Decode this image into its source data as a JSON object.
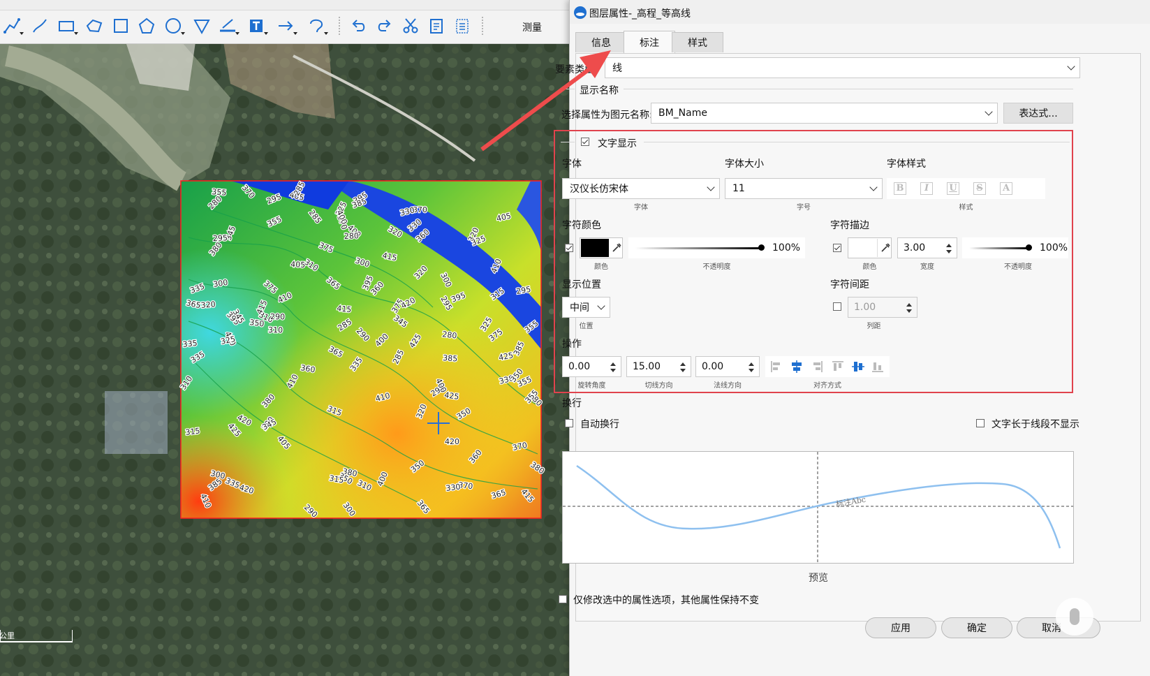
{
  "toolbar": {
    "measure_label": "测量",
    "icons": [
      "polyline-icon",
      "freehand-icon",
      "rectangle-icon",
      "polygon-icon",
      "square-icon",
      "pentagon-icon",
      "circle-icon",
      "triangle-icon",
      "ruler-icon",
      "text-icon",
      "arrow-icon",
      "lasso-icon",
      "undo-icon",
      "redo-icon",
      "scissors-icon",
      "clipboard-icon",
      "list-icon"
    ]
  },
  "map": {
    "scale_label": "公里",
    "contour_labels": [
      "335",
      "310",
      "300",
      "365",
      "370",
      "380",
      "400",
      "410",
      "420",
      "350",
      "320",
      "355",
      "360",
      "395",
      "385",
      "375",
      "345",
      "330",
      "325",
      "315",
      "295",
      "290",
      "285",
      "280",
      "405",
      "415",
      "425"
    ]
  },
  "dialog": {
    "title": "图层属性-_高程_等高线",
    "tabs": [
      "信息",
      "标注",
      "样式"
    ],
    "active_tab": "标注",
    "feature_type_label": "要素类型",
    "feature_type_value": "线",
    "display_name_group": "显示名称",
    "select_attr_label": "选择属性为图元名称:",
    "select_attr_value": "BM_Name",
    "expression_button": "表达式...",
    "text_display_label": "文字显示",
    "text_display_checked": true,
    "font": {
      "label": "字体",
      "value": "汉仪长仿宋体",
      "sub": "字体"
    },
    "font_size": {
      "label": "字体大小",
      "value": "11",
      "sub": "字号"
    },
    "font_style": {
      "label": "字体样式",
      "buttons": [
        "B",
        "I",
        "U",
        "S",
        "A"
      ],
      "sub": "样式"
    },
    "char_color": {
      "label": "字符颜色",
      "checked": true,
      "color": "#000000",
      "color_sub": "颜色",
      "opacity_value": "100%",
      "opacity_fraction": 1.0,
      "opacity_sub": "不透明度"
    },
    "char_stroke": {
      "label": "字符描边",
      "checked": true,
      "color": "#ffffff",
      "color_sub": "颜色",
      "width_value": "3.00",
      "width_sub": "宽度",
      "opacity_value": "100%",
      "opacity_fraction": 1.0,
      "opacity_sub": "不透明度"
    },
    "display_position": {
      "label": "显示位置",
      "value": "中间",
      "sub": "位置"
    },
    "char_spacing": {
      "label": "字符间距",
      "checked": false,
      "value": "1.00",
      "sub": "列距"
    },
    "operations": {
      "label": "操作",
      "rotation": {
        "value": "0.00",
        "sub": "旋转角度"
      },
      "tangent": {
        "value": "15.00",
        "sub": "切线方向"
      },
      "normal": {
        "value": "0.00",
        "sub": "法线方向"
      },
      "align_sub": "对齐方式",
      "align_icons": [
        "align-left-icon",
        "align-center-h-icon",
        "align-right-icon",
        "align-top-icon",
        "align-middle-v-icon",
        "align-bottom-icon"
      ]
    },
    "wrap": {
      "label": "换行",
      "auto_wrap": "自动换行",
      "auto_wrap_checked": false,
      "hide_long": "文字长于线段不显示",
      "hide_long_checked": false
    },
    "preview": {
      "sample_text": "标注Abc",
      "label": "预览"
    },
    "only_modify_selected": "仅修改选中的属性选项，其他属性保持不变",
    "only_modify_checked": false,
    "buttons": {
      "apply": "应用",
      "ok": "确定",
      "cancel": "取消"
    },
    "accent_red": "#e0434d",
    "accent_blue": "#1e6fd0"
  }
}
